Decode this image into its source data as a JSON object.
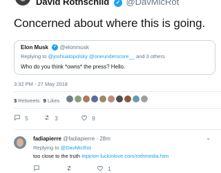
{
  "tweet": {
    "author_name": "David Rothschild",
    "author_handle": "@DavMicRot",
    "text": "Concerned about where this is going.",
    "timestamp": "3:32 PM - 27 May 2018",
    "retweets_count": "3",
    "retweets_label": "Retweets",
    "likes_count": "9",
    "likes_label": "Likes",
    "reply_count": "5",
    "retweet_count": "3",
    "like_count": "9"
  },
  "quote": {
    "author_name": "Elon Musk",
    "author_handle": "@elonmusk",
    "replying_prefix": "Replying to",
    "replying_to": "@joshuatopolsky @oneunderscore__",
    "replying_suffix": "and 3 others",
    "text": "Who do you think *owns* the press? Hello."
  },
  "reply": {
    "author_name": "fadiapierre",
    "author_handle": "@fadiapierre",
    "age": "28m",
    "replying_prefix": "Replying to",
    "replying_to": "@DavMicRot",
    "text": "too close to the truth",
    "hashtag": "#qanon",
    "link": "luckinlove.com/rothmedia.htm",
    "retweet_count": "1"
  },
  "icons": {
    "verified": "verified-badge-icon",
    "reply": "reply-icon",
    "retweet": "retweet-icon",
    "like": "heart-icon",
    "more": "chevron-down-icon"
  },
  "colors": {
    "accent": "#1da1f2",
    "muted": "#657786",
    "text": "#14171a",
    "border": "#ccd6dd"
  },
  "liker_avatar_colors": [
    "#6f7d8c",
    "#8aa07a",
    "#b07a5a",
    "#5a6f9a",
    "#9a8a6a",
    "#c08a7a",
    "#4d4d4d",
    "#8a5a3a",
    "#6a9ab0",
    "#a0a0a0"
  ]
}
